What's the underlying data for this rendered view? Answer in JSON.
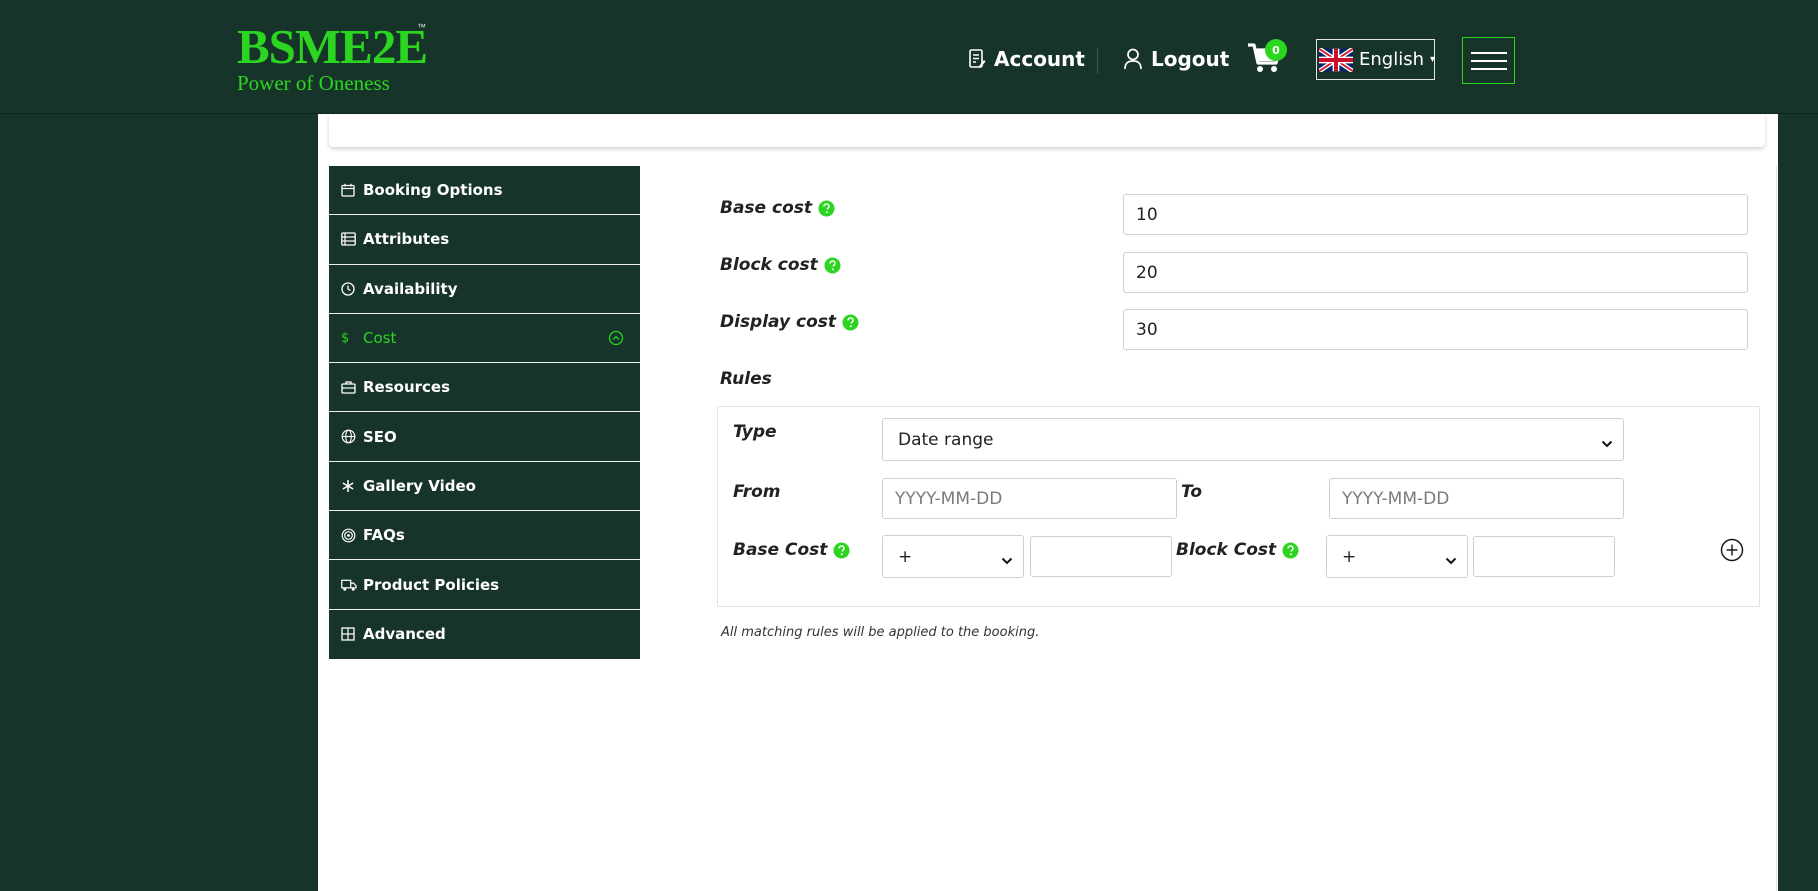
{
  "header": {
    "logo_text": "BSME2E",
    "logo_tm": "™",
    "logo_tagline": "Power of Oneness",
    "nav": {
      "account_label": "Account",
      "logout_label": "Logout",
      "cart_count": "0",
      "language_label": "English",
      "language_caret": "▾"
    },
    "icons": {
      "account": "document-edit-icon",
      "logout": "user-icon",
      "cart": "cart-icon",
      "flag": "uk-flag-icon",
      "menu": "hamburger-menu-icon"
    }
  },
  "sidebar": {
    "items": [
      {
        "label": "Booking Options",
        "icon": "calendar-icon",
        "active": false
      },
      {
        "label": "Attributes",
        "icon": "list-icon",
        "active": false
      },
      {
        "label": "Availability",
        "icon": "clock-icon",
        "active": false
      },
      {
        "label": "Cost",
        "icon": "dollar-icon",
        "active": true
      },
      {
        "label": "Resources",
        "icon": "briefcase-icon",
        "active": false
      },
      {
        "label": "SEO",
        "icon": "globe-icon",
        "active": false
      },
      {
        "label": "Gallery Video",
        "icon": "snowflake-icon",
        "active": false
      },
      {
        "label": "FAQs",
        "icon": "target-icon",
        "active": false
      },
      {
        "label": "Product Policies",
        "icon": "truck-icon",
        "active": false
      },
      {
        "label": "Advanced",
        "icon": "grid-icon",
        "active": false
      }
    ],
    "dollar_symbol": "$"
  },
  "form": {
    "base_cost": {
      "label": "Base cost",
      "value": "10"
    },
    "block_cost": {
      "label": "Block cost",
      "value": "20"
    },
    "display_cost": {
      "label": "Display cost",
      "value": "30"
    },
    "rules_heading": "Rules",
    "rule": {
      "type_label": "Type",
      "type_value": "Date range",
      "from_label": "From",
      "from_placeholder": "YYYY-MM-DD",
      "to_label": "To",
      "to_placeholder": "YYYY-MM-DD",
      "base_cost_label": "Base Cost",
      "base_cost_operator": "+",
      "base_cost_value": "",
      "block_cost_label": "Block Cost",
      "block_cost_operator": "+",
      "block_cost_value": ""
    },
    "note": "All matching rules will be applied to the booking."
  },
  "colors": {
    "brand_dark": "#17342a",
    "accent_green": "#2bd520",
    "white": "#ffffff"
  }
}
